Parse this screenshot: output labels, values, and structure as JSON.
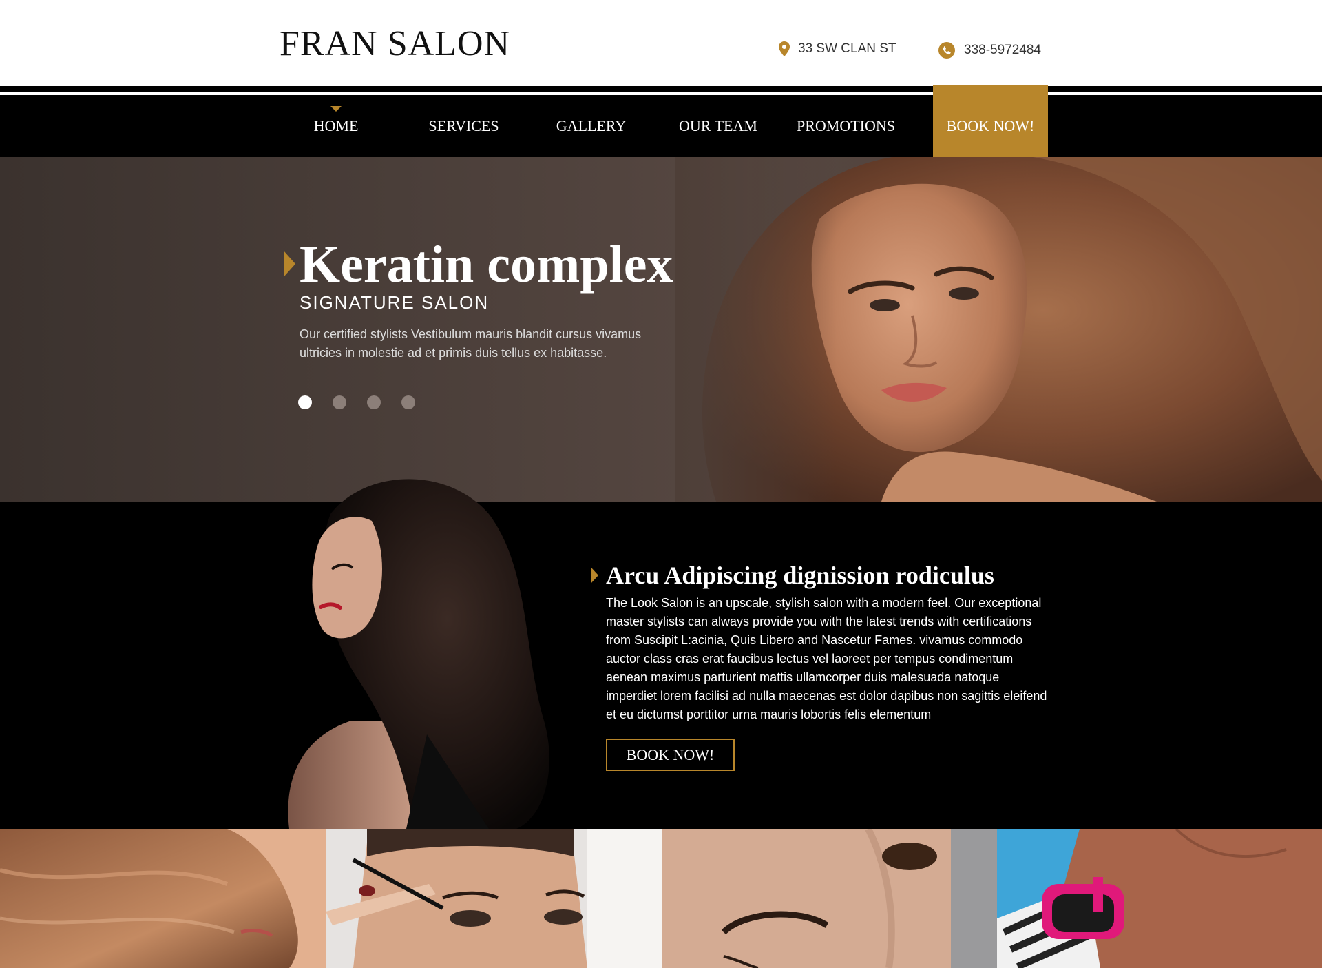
{
  "brand": {
    "name": "FRAN SALON"
  },
  "contact": {
    "address": "33 SW CLAN ST",
    "phone": "338-5972484",
    "address_icon": "map-pin-icon",
    "phone_icon": "phone-icon"
  },
  "nav": {
    "items": [
      {
        "label": "HOME",
        "active": true
      },
      {
        "label": "SERVICES"
      },
      {
        "label": "GALLERY"
      },
      {
        "label": "OUR TEAM"
      },
      {
        "label": "PROMOTIONS"
      }
    ],
    "cta": "BOOK NOW!"
  },
  "hero": {
    "title": "Keratin complex",
    "subtitle": "SIGNATURE SALON",
    "text": "Our certified stylists Vestibulum mauris blandit cursus vivamus ultricies in molestie ad et primis duis tellus ex habitasse.",
    "slides": 4,
    "active_slide": 1
  },
  "about": {
    "title": "Arcu Adipiscing dignission rodiculus",
    "text": "The Look Salon is an upscale, stylish salon with a modern feel. Our exceptional master stylists can always provide you with the latest trends with certifications from Suscipit L:acinia, Quis Libero and Nascetur Fames. vivamus commodo auctor class cras erat faucibus lectus vel laoreet per tempus condimentum aenean maximus parturient mattis ullamcorper duis malesuada natoque imperdiet lorem facilisi ad nulla maecenas est dolor dapibus non sagittis eleifend et eu dictumst porttitor urna mauris lobortis felis elementum",
    "button": "BOOK NOW!"
  },
  "colors": {
    "accent": "#b8862b",
    "header_bg": "#ffffff",
    "nav_bg": "#000000",
    "hero_bg": "#4a3e39",
    "text_light": "#ffffff"
  }
}
